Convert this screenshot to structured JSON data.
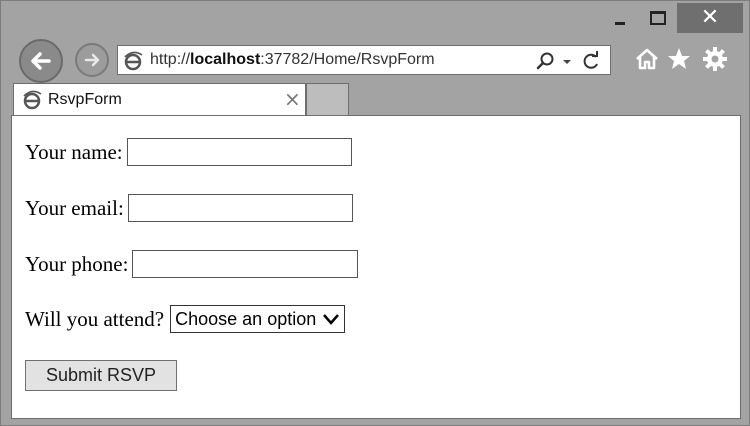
{
  "browser": {
    "window_controls": {
      "minimize": "minimize",
      "maximize": "maximize",
      "close": "✕"
    },
    "address_bar": {
      "protocol": "http://",
      "host": "localhost",
      "rest": ":37782/Home/RsvpForm"
    },
    "tab": {
      "title": "RsvpForm",
      "close": "×"
    },
    "toolbar_icons": [
      "home-icon",
      "star-icon",
      "gear-icon"
    ]
  },
  "form": {
    "name_label": "Your name:",
    "email_label": "Your email:",
    "phone_label": "Your phone:",
    "attend_label": "Will you attend?",
    "attend_select": {
      "selected": "Choose an option"
    },
    "name_value": "",
    "email_value": "",
    "phone_value": "",
    "submit_label": "Submit RSVP"
  }
}
